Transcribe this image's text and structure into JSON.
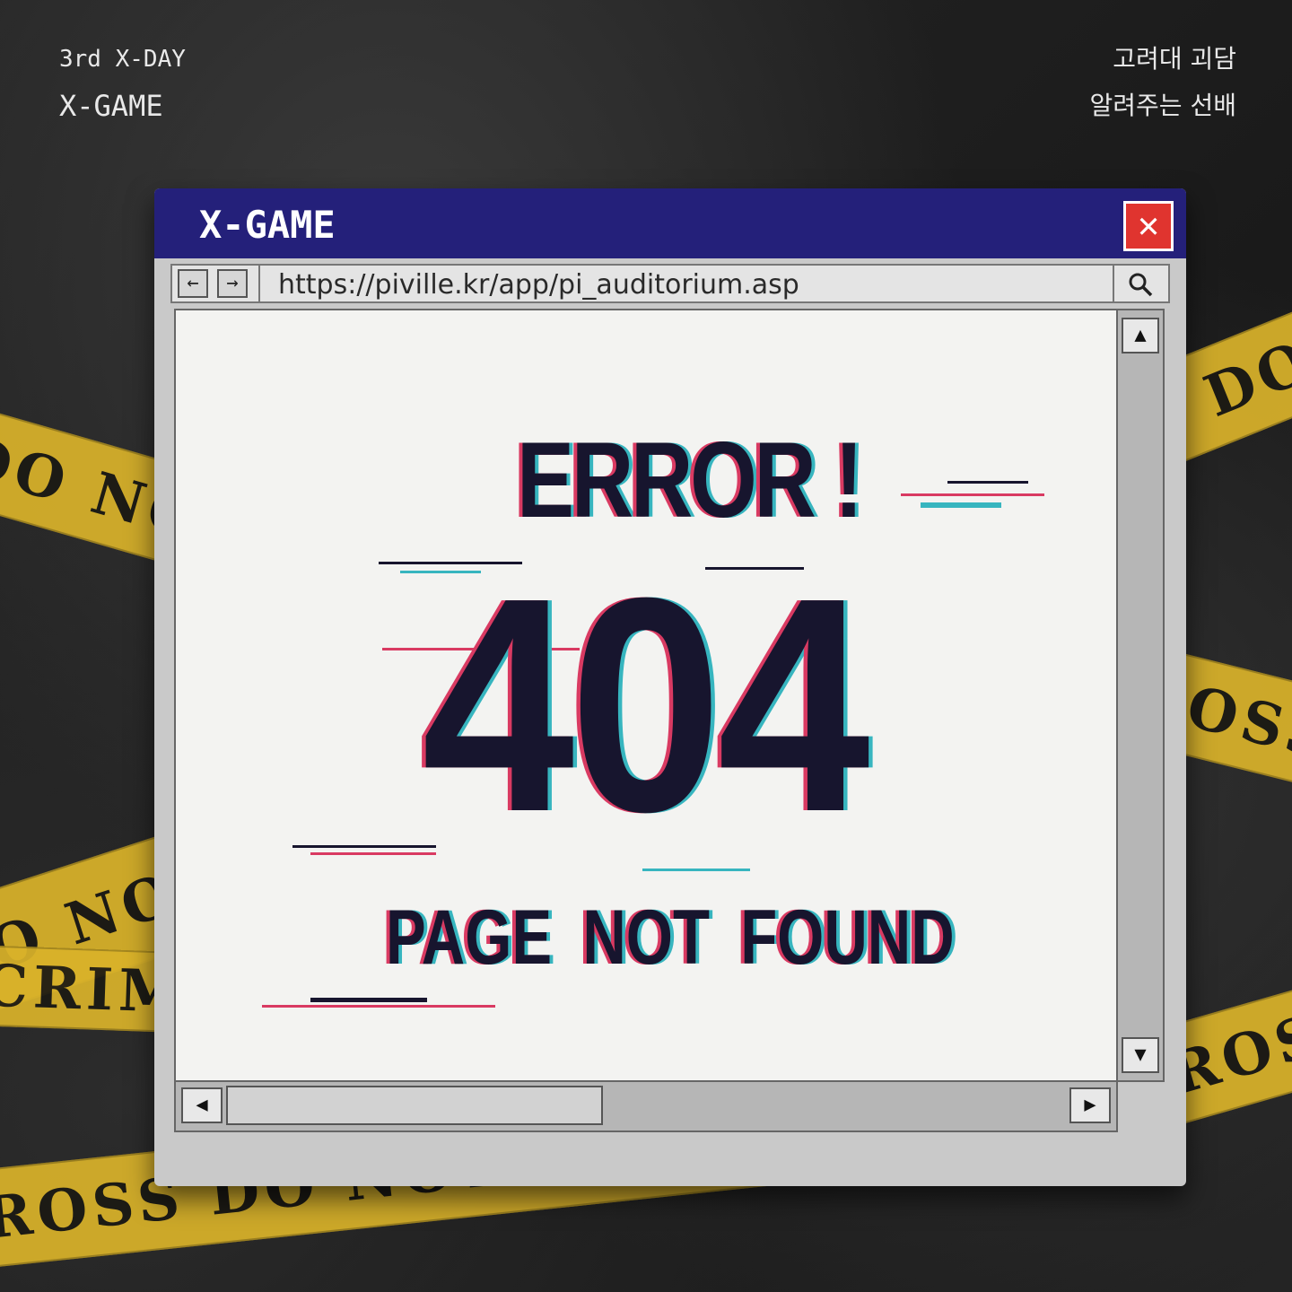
{
  "corner_left": {
    "line1": "3rd X-DAY",
    "line2": "X-GAME"
  },
  "corner_right": {
    "line1": "고려대 괴담",
    "line2": "알려주는 선배"
  },
  "tape": {
    "t1": "DO NO",
    "t2": "S DO",
    "t3": "OSS",
    "t4": "DO NO",
    "t5": "CRIME",
    "t6": "ROSS",
    "t7": "ROSS  DO NOT CR"
  },
  "window": {
    "title": "X-GAME",
    "close_glyph": "✕",
    "url": "https://piville.kr/app/pi_auditorium.asp",
    "back_glyph": "←",
    "forward_glyph": "→",
    "search_icon": "search-icon"
  },
  "page": {
    "heading": "ERROR !",
    "code": "404",
    "message": "PAGE NOT FOUND"
  },
  "scroll": {
    "up": "▲",
    "down": "▼",
    "left": "◀",
    "right": "▶"
  }
}
